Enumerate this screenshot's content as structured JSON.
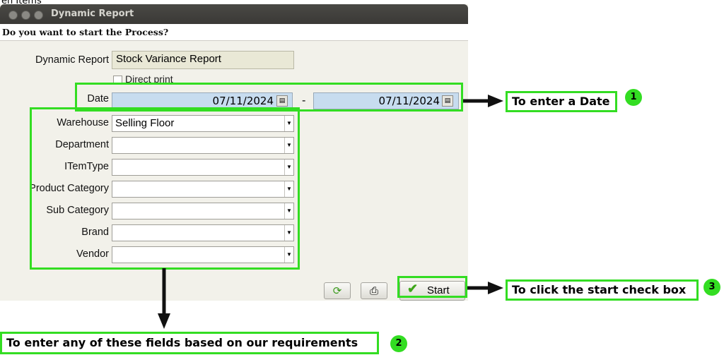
{
  "page": {
    "breadcrumb": "en Items"
  },
  "window": {
    "title": "Dynamic Report",
    "prompt": "Do you want to start the Process?"
  },
  "form": {
    "dynamic_report_label": "Dynamic Report",
    "dynamic_report_value": "Stock Variance Report",
    "direct_print_label": "Direct print",
    "date_label": "Date",
    "date_from": "07/11/2024",
    "date_separator": "-",
    "date_to": "07/11/2024",
    "fields": [
      {
        "label": "Warehouse",
        "value": "Selling Floor"
      },
      {
        "label": "Department",
        "value": ""
      },
      {
        "label": "ITemType",
        "value": ""
      },
      {
        "label": "Product Category",
        "value": ""
      },
      {
        "label": "Sub Category",
        "value": ""
      },
      {
        "label": "Brand",
        "value": ""
      },
      {
        "label": "Vendor",
        "value": ""
      }
    ]
  },
  "buttons": {
    "start_label": "Start"
  },
  "annotations": {
    "callout_1": "To enter a Date",
    "callout_2": "To enter any of these fields  based on our requirements",
    "callout_3": "To click the start check box",
    "badge_1": "1",
    "badge_2": "2",
    "badge_3": "3"
  },
  "colors": {
    "highlight": "#33dd22",
    "date_field": "#c7dcef",
    "titlebar": "#3f3e3a"
  },
  "icons": {
    "refresh": "refresh-icon",
    "print": "printer-icon",
    "start": "checkmark-icon",
    "calendar": "calendar-icon"
  }
}
